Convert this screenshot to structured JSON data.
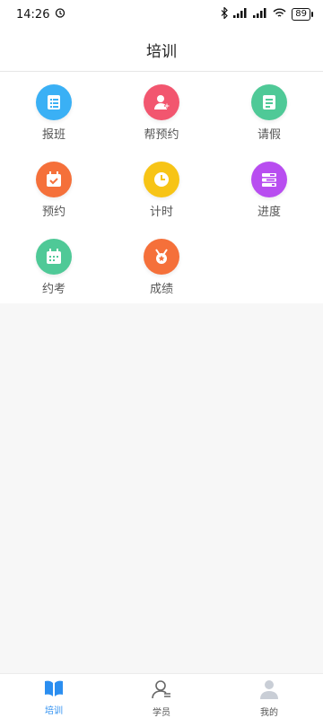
{
  "status_bar": {
    "time": "14:26",
    "battery": "89"
  },
  "header": {
    "title": "培训"
  },
  "grid": [
    {
      "label": "报班",
      "icon": "list-icon",
      "color": "#3ab0f5"
    },
    {
      "label": "帮预约",
      "icon": "add-user-icon",
      "color": "#f2566f"
    },
    {
      "label": "请假",
      "icon": "document-icon",
      "color": "#4fc997"
    },
    {
      "label": "预约",
      "icon": "calendar-check-icon",
      "color": "#f5703a"
    },
    {
      "label": "计时",
      "icon": "clock-icon",
      "color": "#f7c416"
    },
    {
      "label": "进度",
      "icon": "progress-icon",
      "color": "#b84df0"
    },
    {
      "label": "约考",
      "icon": "calendar-icon",
      "color": "#4fc997"
    },
    {
      "label": "成绩",
      "icon": "medal-icon",
      "color": "#f5703a"
    }
  ],
  "tabs": [
    {
      "label": "培训",
      "icon": "book-icon",
      "active": true
    },
    {
      "label": "学员",
      "icon": "student-icon",
      "active": false
    },
    {
      "label": "我的",
      "icon": "profile-icon",
      "active": false
    }
  ],
  "colors": {
    "accent": "#2b8ef0",
    "inactive": "#555555"
  }
}
